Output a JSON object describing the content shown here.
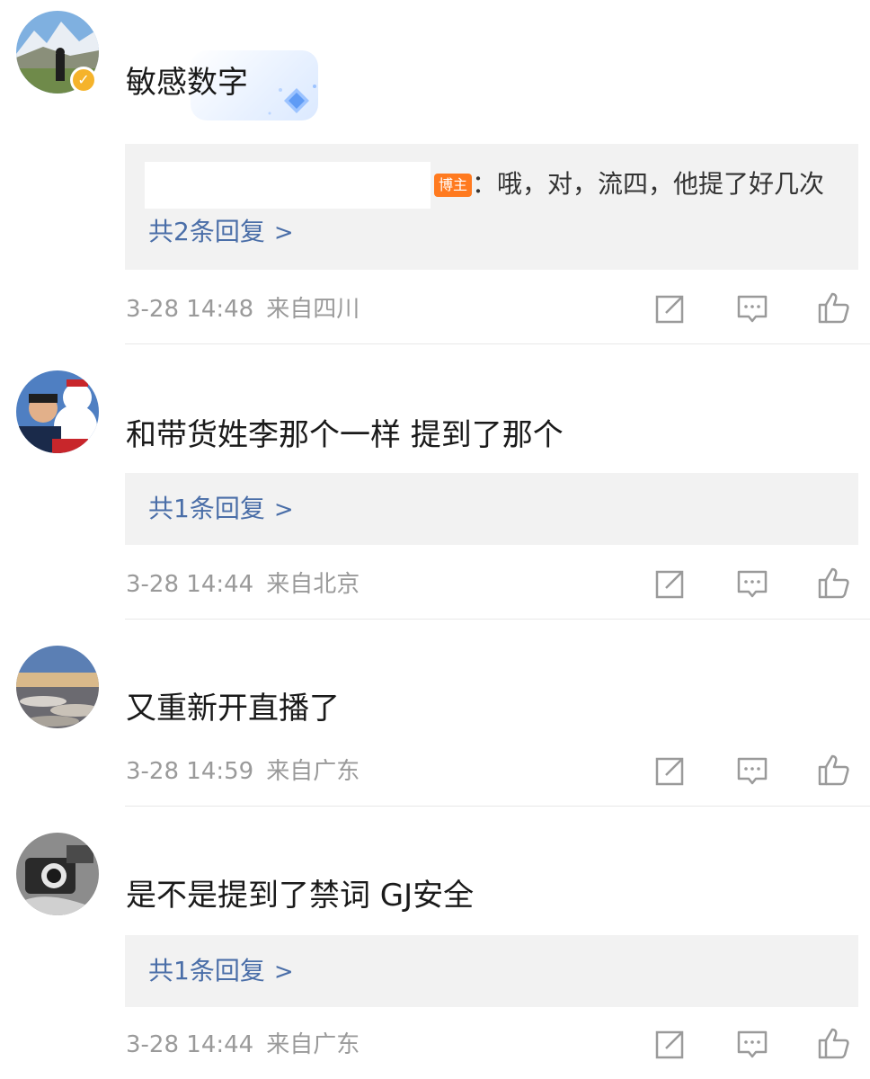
{
  "comments": [
    {
      "text": "敏感数字",
      "has_verified_badge": true,
      "reply": {
        "text": "：哦，对，流四，他提了好几次",
        "tag": "博主"
      },
      "replies_label": "共2条回复",
      "time": "3-28 14:48",
      "location": "来自四川"
    },
    {
      "text": "和带货姓李那个一样 提到了那个",
      "replies_label": "共1条回复",
      "time": "3-28 14:44",
      "location": "来自北京"
    },
    {
      "text": "又重新开直播了",
      "time": "3-28 14:59",
      "location": "来自广东"
    },
    {
      "text": "是不是提到了禁词 GJ安全",
      "replies_label": "共1条回复",
      "time": "3-28 14:44",
      "location": "来自广东"
    }
  ],
  "icons": {
    "forward": "share-edit-icon",
    "comment": "comment-icon",
    "like": "thumbs-up-icon",
    "chevron": "chevron-right-icon",
    "verified": "verified-badge-icon"
  },
  "colors": {
    "link": "#4a6ea8",
    "meta": "#9a9a9a",
    "reply_bg": "#f2f2f2",
    "badge": "#f5b32b",
    "tag": "#ff7a1f"
  }
}
